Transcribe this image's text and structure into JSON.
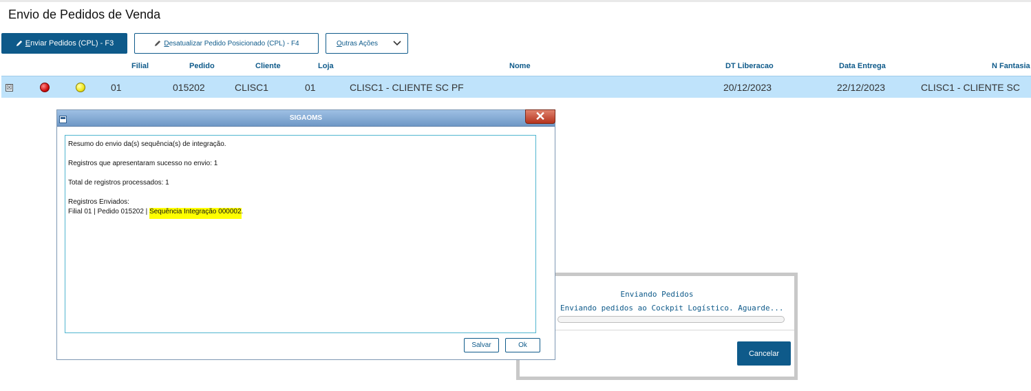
{
  "page": {
    "title": "Envio de Pedidos de Venda"
  },
  "toolbar": {
    "send_label_hotkey": "E",
    "send_label_rest": "nviar Pedidos (CPL) - F3",
    "desat_label_hotkey": "D",
    "desat_label_rest": "esatualizar Pedido Posicionado (CPL) - F4",
    "outras_label_hotkey": "O",
    "outras_label_rest": "utras Ações"
  },
  "table": {
    "columns": [
      "Filial",
      "Pedido",
      "Cliente",
      "Loja",
      "Nome",
      "DT Liberacao",
      "Data Entrega",
      "N Fantasia"
    ],
    "rows": [
      {
        "checkbox": "☒",
        "status1": "red",
        "status2": "yellow",
        "filial": "01",
        "pedido": "015202",
        "cliente": "CLISC1",
        "loja": "01",
        "nome": "CLISC1 - CLIENTE SC PF",
        "dt_liberacao": "20/12/2023",
        "data_entrega": "22/12/2023",
        "n_fantasia": "CLISC1 - CLIENTE SC"
      }
    ]
  },
  "progress": {
    "title": "Enviando Pedidos",
    "message": "Enviando pedidos ao Cockpit Logístico. Aguarde...",
    "fraction": 0.0,
    "cancel_label": "Cancelar"
  },
  "dialog": {
    "title": "SIGAOMS",
    "close_glyph": "✕",
    "lines": {
      "l1": "Resumo do envio da(s) sequência(s) de integração.",
      "l2": "Registros que apresentaram sucesso no envio: 1",
      "l3": "Total de registros processados: 1",
      "l4": "Registros Enviados:",
      "l5_prefix": "Filial 01 | Pedido 015202 | ",
      "l5_highlight": "Sequência Integração 000002",
      "l5_suffix": "."
    },
    "save_label": "Salvar",
    "ok_label": "Ok"
  },
  "colors": {
    "accent": "#0e5a8a",
    "row_selected": "#bfe3fb",
    "highlight": "#ffff00"
  }
}
